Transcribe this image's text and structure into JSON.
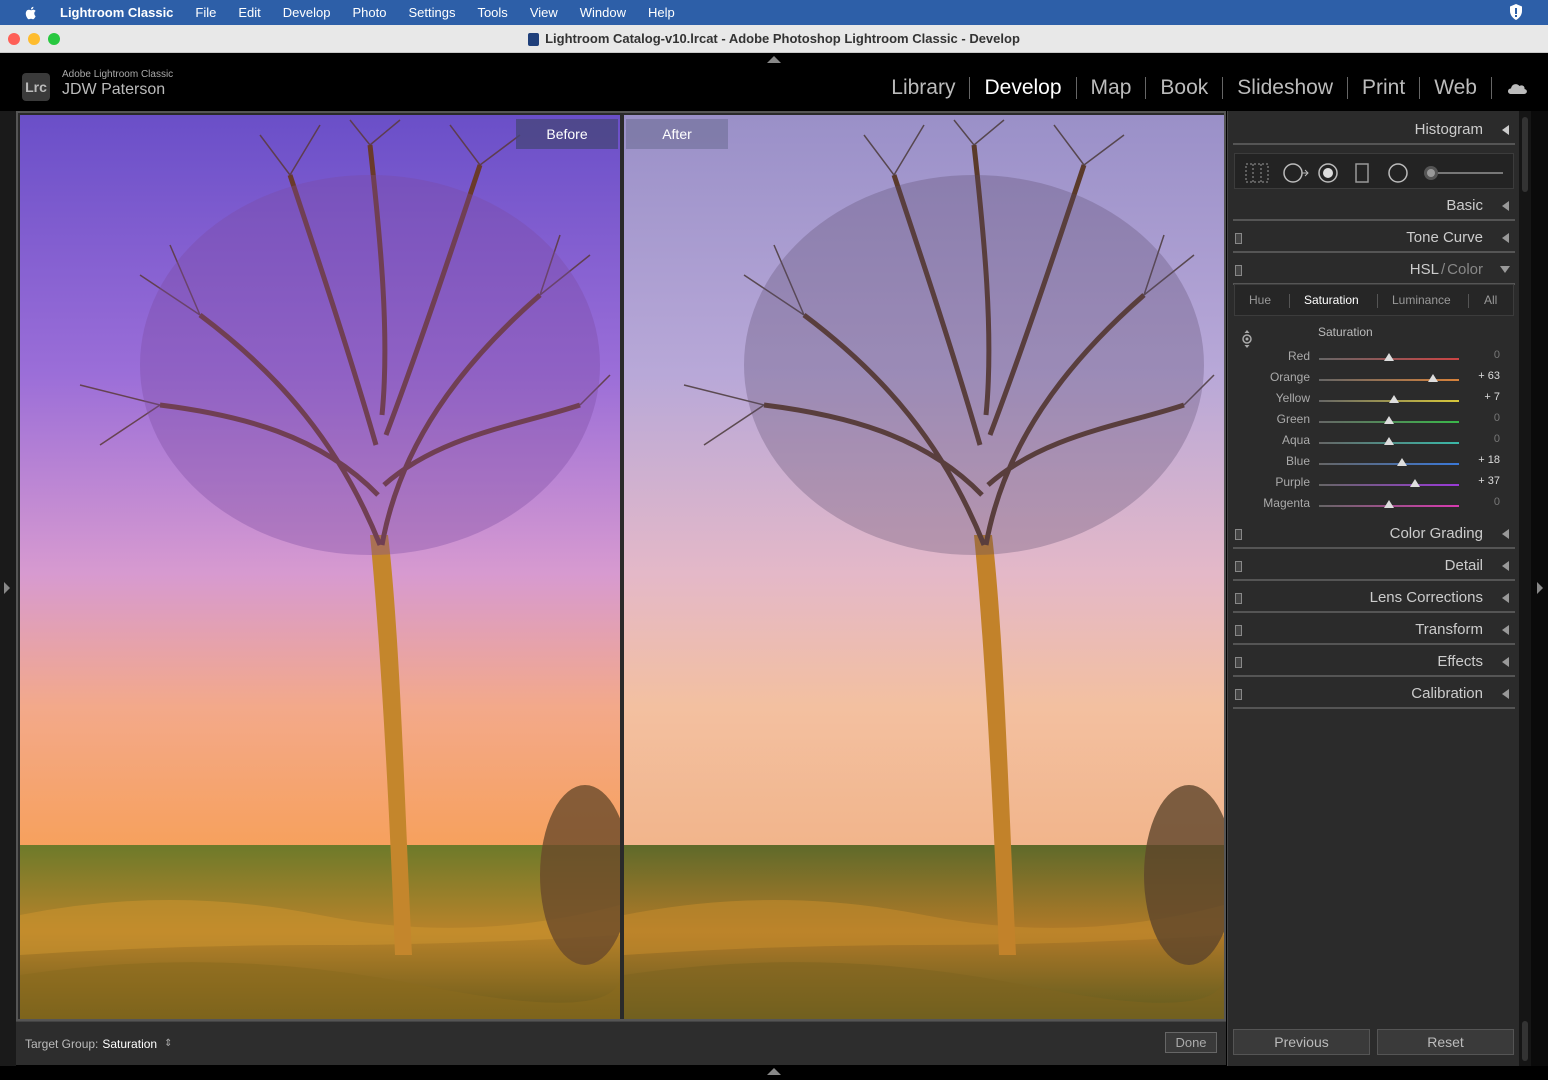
{
  "menubar": {
    "items": [
      "Lightroom Classic",
      "File",
      "Edit",
      "Develop",
      "Photo",
      "Settings",
      "Tools",
      "View",
      "Window",
      "Help"
    ]
  },
  "window": {
    "title": "Lightroom Catalog-v10.lrcat - Adobe Photoshop Lightroom Classic - Develop"
  },
  "identity": {
    "logo": "Lrc",
    "product": "Adobe Lightroom Classic",
    "user": "JDW Paterson"
  },
  "modules": [
    "Library",
    "Develop",
    "Map",
    "Book",
    "Slideshow",
    "Print",
    "Web"
  ],
  "active_module": "Develop",
  "viewer": {
    "before_label": "Before",
    "after_label": "After"
  },
  "toolbar": {
    "target_group_label": "Target Group:",
    "target_group_value": "Saturation",
    "done_label": "Done"
  },
  "panels": {
    "histogram": "Histogram",
    "basic": "Basic",
    "tone_curve": "Tone Curve",
    "hsl": "HSL",
    "hsl_sep": " / ",
    "color": "Color",
    "color_grading": "Color Grading",
    "detail": "Detail",
    "lens_corrections": "Lens Corrections",
    "transform": "Transform",
    "effects": "Effects",
    "calibration": "Calibration"
  },
  "hsl": {
    "tabs": [
      "Hue",
      "Saturation",
      "Luminance",
      "All"
    ],
    "active_tab": "Saturation",
    "group_title": "Saturation",
    "sliders": [
      {
        "label": "Red",
        "value": 0,
        "display": "0",
        "color": "#c44"
      },
      {
        "label": "Orange",
        "value": 63,
        "display": "+ 63",
        "color": "#d8823a"
      },
      {
        "label": "Yellow",
        "value": 7,
        "display": "+ 7",
        "color": "#d8c83a"
      },
      {
        "label": "Green",
        "value": 0,
        "display": "0",
        "color": "#3ab84a"
      },
      {
        "label": "Aqua",
        "value": 0,
        "display": "0",
        "color": "#3ab8a8"
      },
      {
        "label": "Blue",
        "value": 18,
        "display": "+ 18",
        "color": "#3a78d8"
      },
      {
        "label": "Purple",
        "value": 37,
        "display": "+ 37",
        "color": "#9a3ad8"
      },
      {
        "label": "Magenta",
        "value": 0,
        "display": "0",
        "color": "#d83ab0"
      }
    ]
  },
  "buttons": {
    "previous": "Previous",
    "reset": "Reset"
  }
}
